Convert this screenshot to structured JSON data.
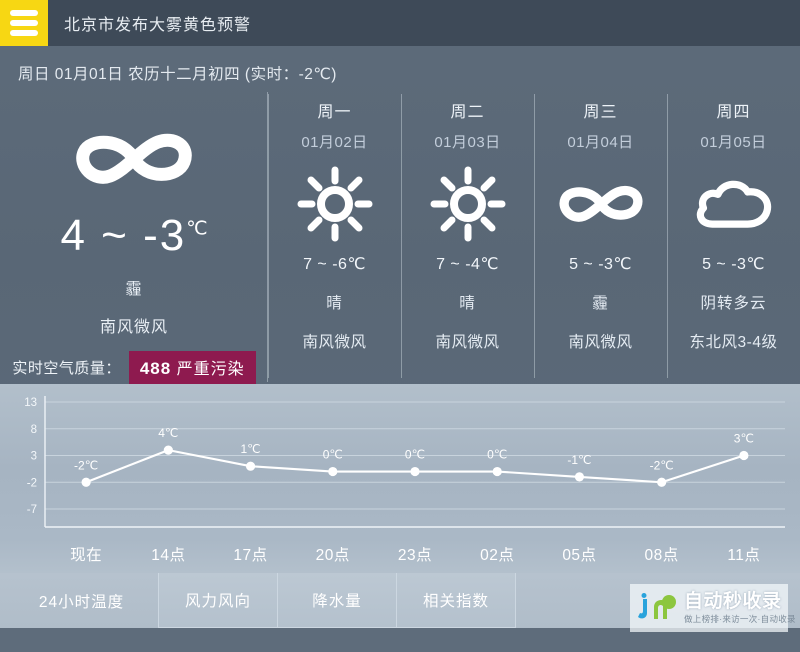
{
  "alert": {
    "icon": "warning-bars-icon",
    "icon_color": "#f7d713",
    "text": "北京市发布大雾黄色预警",
    "bar_color": "#3e4a58"
  },
  "today_line": "周日 01月01日 农历十二月初四 (实时：-2℃)",
  "today": {
    "icon": "haze-icon",
    "temp_range": "4 ~ -3",
    "temp_unit": "℃",
    "condition": "霾",
    "wind": "南风微风",
    "aqi_label": "实时空气质量：",
    "aqi_value": "488",
    "aqi_level": "严重污染",
    "aqi_color": "#8e1a4f"
  },
  "forecast": [
    {
      "dayname": "周一",
      "date": "01月02日",
      "icon": "sun-icon",
      "temp": "7 ~ -6℃",
      "condition": "晴",
      "wind": "南风微风"
    },
    {
      "dayname": "周二",
      "date": "01月03日",
      "icon": "sun-icon",
      "temp": "7 ~ -4℃",
      "condition": "晴",
      "wind": "南风微风"
    },
    {
      "dayname": "周三",
      "date": "01月04日",
      "icon": "haze-icon",
      "temp": "5 ~ -3℃",
      "condition": "霾",
      "wind": "南风微风"
    },
    {
      "dayname": "周四",
      "date": "01月05日",
      "icon": "cloud-icon",
      "temp": "5 ~ -3℃",
      "condition": "阴转多云",
      "wind": "东北风3-4级"
    }
  ],
  "chart_data": {
    "type": "line",
    "title": "24小时温度",
    "xlabel": "",
    "ylabel": "",
    "categories": [
      "现在",
      "14点",
      "17点",
      "20点",
      "23点",
      "02点",
      "05点",
      "08点",
      "11点"
    ],
    "values": [
      -2,
      4,
      1,
      0,
      0,
      0,
      -1,
      -2,
      3
    ],
    "point_labels": [
      "-2℃",
      "4℃",
      "1℃",
      "0℃",
      "0℃",
      "0℃",
      "-1℃",
      "-2℃",
      "3℃"
    ],
    "yticks": [
      13,
      8,
      3,
      -2,
      -7
    ],
    "ylim": [
      -7,
      13
    ],
    "grid": true,
    "legend": "none",
    "line_color": "#ffffff",
    "point_color": "#ffffff"
  },
  "tabs": [
    {
      "label": "24小时温度",
      "active": true
    },
    {
      "label": "风力风向",
      "active": false
    },
    {
      "label": "降水量",
      "active": false
    },
    {
      "label": "相关指数",
      "active": false
    }
  ],
  "watermark": {
    "logo": "jn-logo-icon",
    "title": "自动秒收录",
    "subtitle": "做上榜排·来访一次·自动收录"
  }
}
